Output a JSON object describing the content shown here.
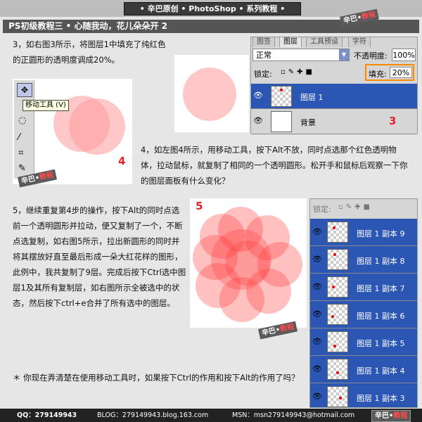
{
  "header": {
    "banner": "• 辛巴原创 • PhotoShop • 系列教程 •"
  },
  "title": "PS初级教程三 • 心随我动，花儿朵朵开 2",
  "watermark": {
    "left": "辛巴",
    "dot": "•",
    "right": "教程"
  },
  "step3": {
    "text": "3，如右图3所示，将图层1中填充了纯红色的正圆形的透明度调成20%。",
    "number": "3"
  },
  "step4": {
    "tooltip": "移动工具 (V)",
    "number": "4",
    "text": "4，如左图4所示，用移动工具，按下Alt不放，同时点选那个红色透明物体，拉动鼠标，就复制了相同的一个透明圆形。松开手和鼠标后观察一下你的图层面板有什么变化？"
  },
  "step5": {
    "number": "5",
    "text": "5，继续重复第4步的操作，按下Alt的同时点选前一个透明圆形并拉动，便又复制了一个，不断点选复制，如右图5所示，拉出新圆形的同时并将其摆放好直至最后形成一朵大红花样的图形，此例中，我共复制了9层。完成后按下Ctrl选中图层1及其所有复制层，如右图所示全被选中的状态，然后按下ctrl+e合并了所有选中的图层。"
  },
  "note": "＊ 你现在弄清楚在使用移动工具时，如果按下Ctrl的作用和按下Alt的作用了吗？",
  "layers_panel_top": {
    "tabs": [
      "图签",
      "图层",
      "工具预设",
      "字符"
    ],
    "blend_mode": "正常",
    "opacity_label": "不透明度:",
    "opacity_value": "100%",
    "lock_label": "锁定:",
    "fill_label": "填充:",
    "fill_value": "20%",
    "layers": [
      {
        "name": "图层 1",
        "selected": true
      },
      {
        "name": "背景",
        "selected": false
      }
    ]
  },
  "layers_panel_bottom": {
    "lock_label": "锁定:",
    "layers": [
      "图层 1 副本 9",
      "图层 1 副本 8",
      "图层 1 副本 7",
      "图层 1 副本 6",
      "图层 1 副本 5",
      "图层 1 副本 4",
      "图层 1 副本 3"
    ]
  },
  "footer": {
    "qq": "QQ：279149943",
    "blog": "BLOG：279149943.blog.163.com",
    "msn": "MSN：msn279149943@hotmail.com"
  },
  "colors": {
    "accent_red": "#e8202a",
    "selected_blue": "#2b56b3",
    "circle": "#ff9a9a",
    "fill_highlight": "#ff8a00"
  }
}
